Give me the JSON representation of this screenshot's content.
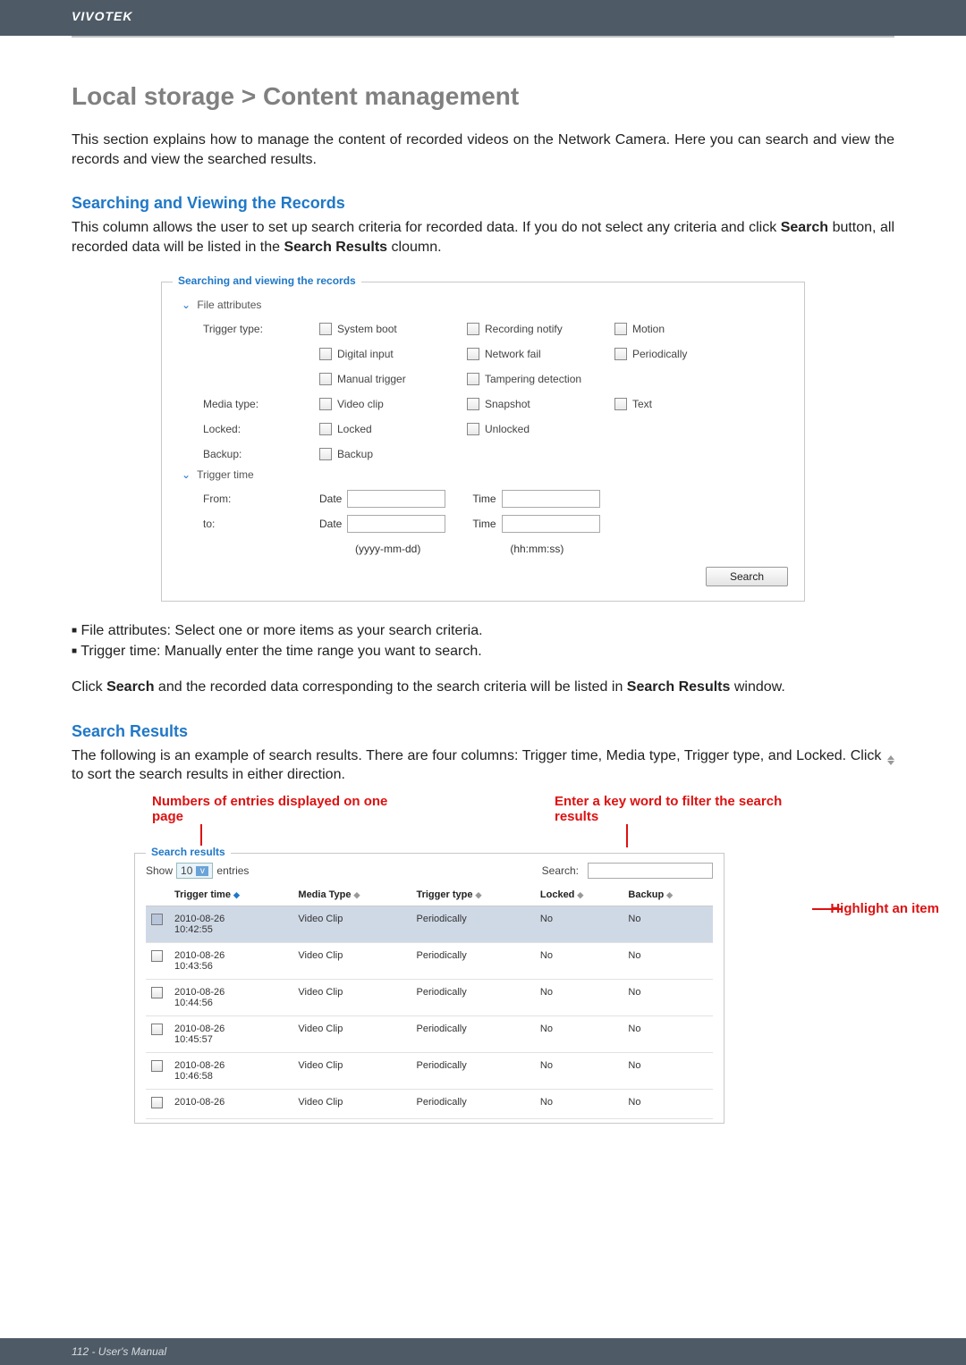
{
  "brand": "VIVOTEK",
  "title": "Local storage > Content management",
  "intro": "This section explains how to manage the content of recorded videos on the Network Camera. Here you can search and view the records and view the searched results.",
  "searching": {
    "heading": "Searching and Viewing the Records",
    "desc_pre": "This column allows the user to set up search criteria for recorded data. If you do not select any criteria and click ",
    "desc_bold1": "Search",
    "desc_mid": " button, all recorded data will be listed in the ",
    "desc_bold2": "Search Results",
    "desc_post": " cloumn.",
    "fieldset_legend": "Searching and viewing the records",
    "file_attributes": "File attributes",
    "trigger_type_label": "Trigger type:",
    "trigger_opts_row1": [
      "System boot",
      "Recording notify",
      "Motion"
    ],
    "trigger_opts_row2": [
      "Digital input",
      "Network fail",
      "Periodically"
    ],
    "trigger_opts_row3": [
      "Manual trigger",
      "Tampering detection"
    ],
    "media_type_label": "Media type:",
    "media_opts": [
      "Video clip",
      "Snapshot",
      "Text"
    ],
    "locked_label": "Locked:",
    "locked_opts": [
      "Locked",
      "Unlocked"
    ],
    "backup_label": "Backup:",
    "backup_opts": [
      "Backup"
    ],
    "trigger_time": "Trigger time",
    "from_label": "From:",
    "to_label": "to:",
    "date_label": "Date",
    "time_label": "Time",
    "date_hint": "(yyyy-mm-dd)",
    "time_hint": "(hh:mm:ss)",
    "search_btn": "Search"
  },
  "bullets": {
    "b1": "File attributes: Select one or more items as your search criteria.",
    "b2": "Trigger time: Manually enter the time range you want to search."
  },
  "click_search": {
    "pre": "Click ",
    "b1": "Search",
    "mid": " and the recorded data corresponding to the search criteria will be listed in ",
    "b2": "Search Results",
    "post": " window."
  },
  "results": {
    "heading": "Search Results",
    "desc": "The following is an example of search results. There are four columns: Trigger time, Media type, Trigger type, and Locked. Click ",
    "desc_post": " to sort the search results in either direction.",
    "annot_left": "Numbers of entries displayed on one page",
    "annot_right": "Enter a key word to filter the search results",
    "annot_highlight": "Highlight an item",
    "fieldset_legend": "Search results",
    "show": "Show",
    "show_value": "10",
    "entries": "entries",
    "search_label": "Search:",
    "cols": [
      "Trigger time",
      "Media Type",
      "Trigger type",
      "Locked",
      "Backup"
    ],
    "rows": [
      {
        "time": "2010-08-26 10:42:55",
        "media": "Video Clip",
        "trigger": "Periodically",
        "locked": "No",
        "backup": "No",
        "hl": true,
        "checked": true
      },
      {
        "time": "2010-08-26 10:43:56",
        "media": "Video Clip",
        "trigger": "Periodically",
        "locked": "No",
        "backup": "No"
      },
      {
        "time": "2010-08-26 10:44:56",
        "media": "Video Clip",
        "trigger": "Periodically",
        "locked": "No",
        "backup": "No"
      },
      {
        "time": "2010-08-26 10:45:57",
        "media": "Video Clip",
        "trigger": "Periodically",
        "locked": "No",
        "backup": "No"
      },
      {
        "time": "2010-08-26 10:46:58",
        "media": "Video Clip",
        "trigger": "Periodically",
        "locked": "No",
        "backup": "No"
      },
      {
        "time": "2010-08-26",
        "media": "Video Clip",
        "trigger": "Periodically",
        "locked": "No",
        "backup": "No"
      }
    ]
  },
  "footer": "112 - User's Manual"
}
